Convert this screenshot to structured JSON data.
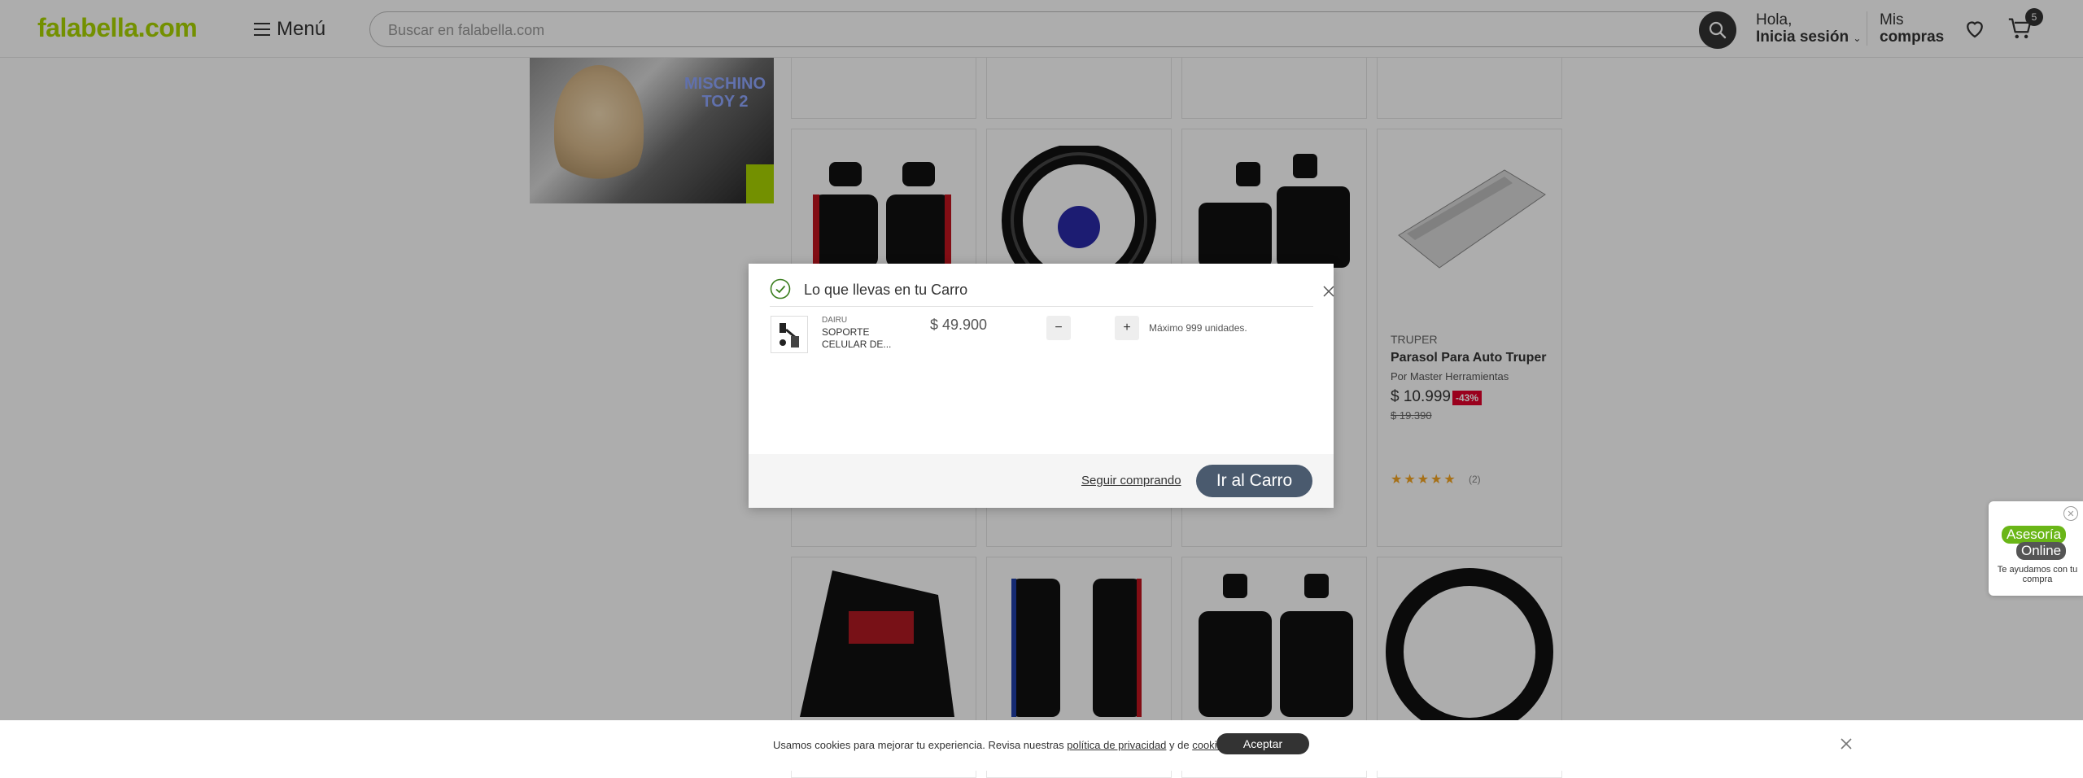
{
  "header": {
    "logo": "falabella",
    "logo_suffix": ".com",
    "menu_label": "Menú",
    "search_placeholder": "Buscar en falabella.com",
    "greeting": "Hola,",
    "login_label": "Inicia sesión",
    "my_orders_l1": "Mis",
    "my_orders_l2": "compras",
    "cart_count": "5"
  },
  "banner": {
    "brand_line1": "MISCHINO",
    "brand_line2": "TOY 2"
  },
  "products": [
    {
      "brand": "TRUPER",
      "title": "Parasol Para Auto Truper",
      "seller": "Por Master Herramientas",
      "price": "$ 10.999",
      "discount": "-43%",
      "old_price": "$ 19.390",
      "stars": "★★★★★",
      "reviews": "(2)"
    }
  ],
  "modal": {
    "title": "Lo que llevas en tu Carro",
    "item": {
      "brand": "DAIRU",
      "name_l1": "SOPORTE",
      "name_l2": "CELULAR DE...",
      "price": "$ 49.900",
      "minus": "−",
      "plus": "+",
      "max_note": "Máximo 999 unidades."
    },
    "keep_shopping": "Seguir comprando",
    "go_to_cart": "Ir al Carro"
  },
  "chat": {
    "line1": "Asesoría",
    "line2": "Online",
    "subtitle": "Te ayudamos con tu compra"
  },
  "cookie": {
    "text_before": "Usamos cookies para mejorar tu experiencia. Revisa nuestras ",
    "privacy_link": "política de privacidad",
    "text_mid": " y de ",
    "cookies_link": "cookies",
    "text_after": ".",
    "accept": "Aceptar"
  },
  "colors": {
    "brand_green": "#aad500",
    "button_dark": "#4a5a6e",
    "discount_red": "#e4002b"
  }
}
